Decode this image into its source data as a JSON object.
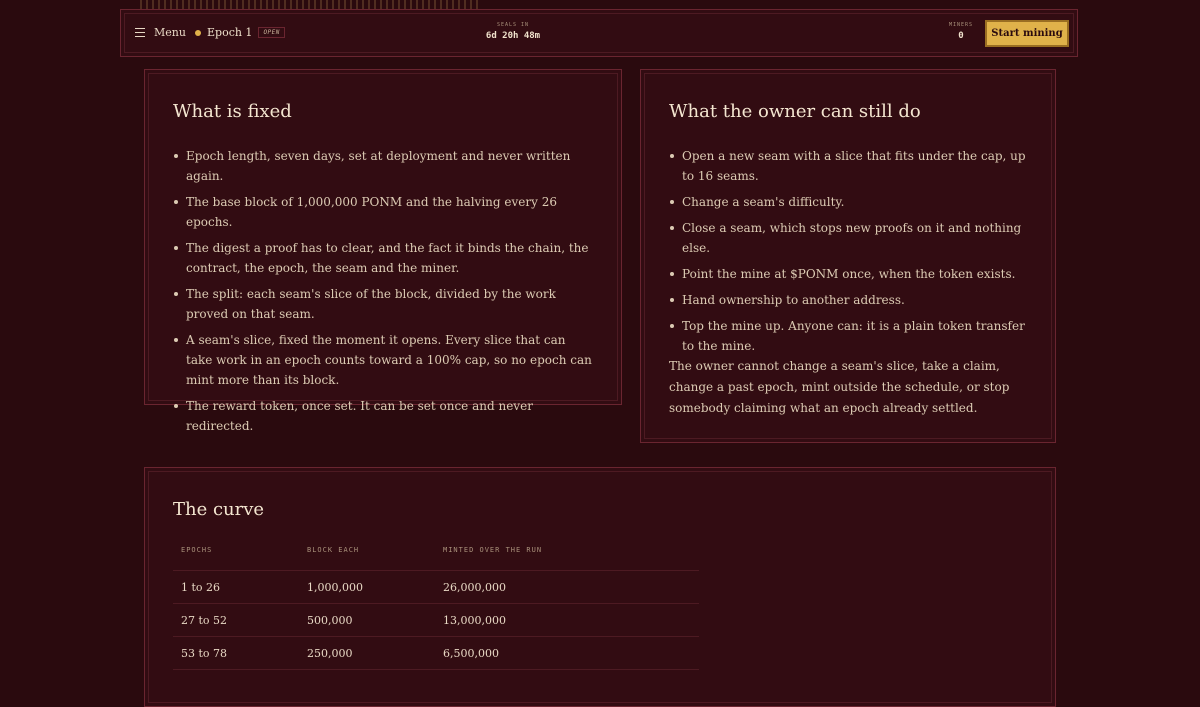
{
  "topbar": {
    "menu_label": "Menu",
    "epoch_label": "Epoch 1",
    "epoch_badge": "OPEN",
    "seals_label": "SEALS IN",
    "seals_value": "6d 20h 48m",
    "miners_label": "MINERS",
    "miners_value": "0",
    "start_label": "Start mining"
  },
  "fixed": {
    "title": "What is fixed",
    "items": [
      "Epoch length, seven days, set at deployment and never written again.",
      "The base block of 1,000,000 PONM and the halving every 26 epochs.",
      "The digest a proof has to clear, and the fact it binds the chain, the contract, the epoch, the seam and the miner.",
      "The split: each seam's slice of the block, divided by the work proved on that seam.",
      "A seam's slice, fixed the moment it opens. Every slice that can take work in an epoch counts toward a 100% cap, so no epoch can mint more than its block.",
      "The reward token, once set. It can be set once and never redirected."
    ]
  },
  "owner": {
    "title": "What the owner can still do",
    "items": [
      "Open a new seam with a slice that fits under the cap, up to 16 seams.",
      "Change a seam's difficulty.",
      "Close a seam, which stops new proofs on it and nothing else.",
      "Point the mine at $PONM once, when the token exists.",
      "Hand ownership to another address.",
      "Top the mine up. Anyone can: it is a plain token transfer to the mine."
    ],
    "note": "The owner cannot change a seam's slice, take a claim, change a past epoch, mint outside the schedule, or stop somebody claiming what an epoch already settled."
  },
  "curve": {
    "title": "The curve",
    "headers": [
      "EPOCHS",
      "BLOCK EACH",
      "MINTED OVER THE RUN"
    ],
    "rows": [
      [
        "1 to 26",
        "1,000,000",
        "26,000,000"
      ],
      [
        "27 to 52",
        "500,000",
        "13,000,000"
      ],
      [
        "53 to 78",
        "250,000",
        "6,500,000"
      ]
    ]
  },
  "colors": {
    "background": "#2a0a0e",
    "panel": "#320c12",
    "border": "#6a2530",
    "accent": "#e0b24a"
  }
}
